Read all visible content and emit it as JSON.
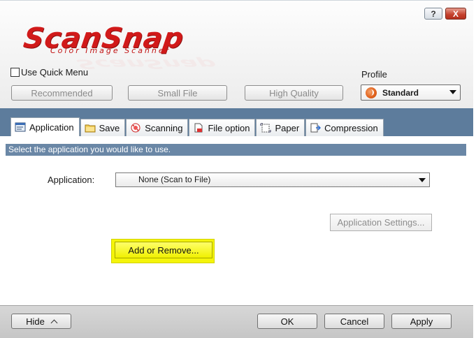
{
  "window": {
    "help_label": "?",
    "close_label": "X"
  },
  "logo": {
    "brand": "ScanSnap",
    "tagline": "Color Image Scanner"
  },
  "header": {
    "quick_menu_label": "Use Quick Menu",
    "quick_menu_checked": false,
    "profile_label": "Profile",
    "presets": [
      "Recommended",
      "Small File",
      "High Quality"
    ],
    "profile_selected": "Standard"
  },
  "tabs": [
    {
      "label": "Application",
      "icon": "application-icon",
      "active": true
    },
    {
      "label": "Save",
      "icon": "folder-icon",
      "active": false
    },
    {
      "label": "Scanning",
      "icon": "scanning-icon",
      "active": false
    },
    {
      "label": "File option",
      "icon": "file-option-icon",
      "active": false
    },
    {
      "label": "Paper",
      "icon": "paper-icon",
      "active": false
    },
    {
      "label": "Compression",
      "icon": "compression-icon",
      "active": false
    }
  ],
  "content": {
    "instruction": "Select the application you would like to use.",
    "application_label": "Application:",
    "application_selected": "None (Scan to File)",
    "app_settings_label": "Application Settings...",
    "add_remove_label": "Add or Remove..."
  },
  "footer": {
    "hide_label": "Hide",
    "ok_label": "OK",
    "cancel_label": "Cancel",
    "apply_label": "Apply"
  },
  "colors": {
    "brand_red": "#d11a1a",
    "tab_strip": "#5d7c9c",
    "instruction_bar": "#6a87a6",
    "highlight": "#f4f40a"
  }
}
